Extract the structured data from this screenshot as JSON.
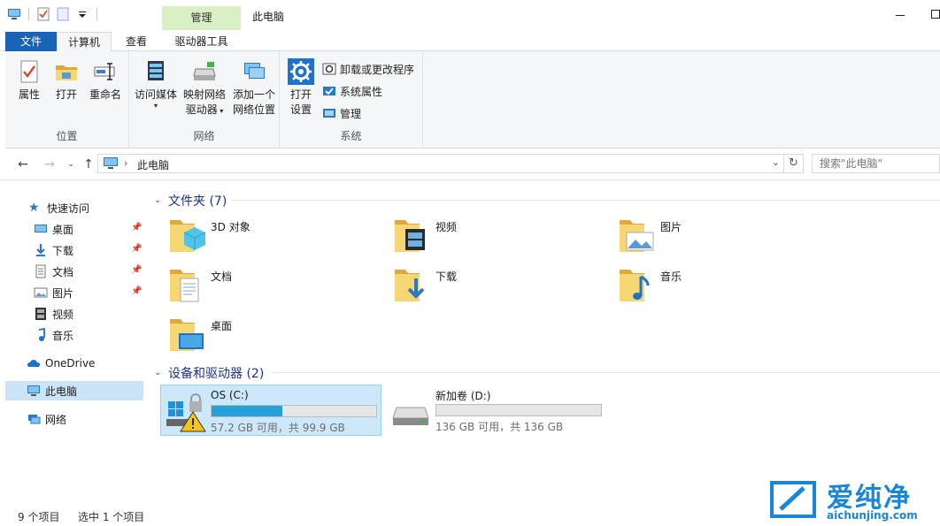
{
  "window": {
    "title": "此电脑",
    "manage_context_tab": "管理"
  },
  "ribbon_tabs": {
    "file": "文件",
    "computer": "计算机",
    "view": "查看",
    "drive_tools": "驱动器工具"
  },
  "ribbon": {
    "location_group": {
      "label": "位置",
      "properties": "属性",
      "open": "打开",
      "rename": "重命名"
    },
    "network_group": {
      "label": "网络",
      "access_media": "访问媒体",
      "map_drive_line1": "映射网络",
      "map_drive_line2": "驱动器",
      "add_location_line1": "添加一个",
      "add_location_line2": "网络位置"
    },
    "system_group": {
      "label": "系统",
      "open_settings_line1": "打开",
      "open_settings_line2": "设置",
      "uninstall": "卸载或更改程序",
      "system_properties": "系统属性",
      "manage": "管理"
    }
  },
  "address": {
    "path": "此电脑",
    "search_placeholder": "搜索\"此电脑\""
  },
  "sidebar": {
    "quick_access": "快速访问",
    "items": [
      {
        "label": "桌面",
        "pinned": true
      },
      {
        "label": "下载",
        "pinned": true
      },
      {
        "label": "文档",
        "pinned": true
      },
      {
        "label": "图片",
        "pinned": true
      },
      {
        "label": "视频",
        "pinned": false
      },
      {
        "label": "音乐",
        "pinned": false
      }
    ],
    "onedrive": "OneDrive",
    "this_pc": "此电脑",
    "network": "网络"
  },
  "folders_section": {
    "title": "文件夹 (7)",
    "folders": [
      {
        "label": "3D 对象",
        "icon": "3d-objects-folder-icon"
      },
      {
        "label": "视频",
        "icon": "videos-folder-icon"
      },
      {
        "label": "图片",
        "icon": "pictures-folder-icon"
      },
      {
        "label": "文档",
        "icon": "documents-folder-icon"
      },
      {
        "label": "下载",
        "icon": "downloads-folder-icon"
      },
      {
        "label": "音乐",
        "icon": "music-folder-icon"
      },
      {
        "label": "桌面",
        "icon": "desktop-folder-icon"
      }
    ]
  },
  "drives_section": {
    "title": "设备和驱动器 (2)",
    "drives": [
      {
        "label": "OS (C:)",
        "size_text": "57.2 GB 可用，共 99.9 GB",
        "used_fraction": 0.43,
        "selected": true
      },
      {
        "label": "新加卷 (D:)",
        "size_text": "136 GB 可用，共 136 GB",
        "used_fraction": 0.0,
        "selected": false
      }
    ]
  },
  "status": {
    "item_count": "9 个项目",
    "selected": "选中 1 个项目"
  },
  "watermark": {
    "title": "爱纯净",
    "url": "aichunjing.com"
  },
  "colors": {
    "accent": "#1a64b8",
    "selection": "#cce8fa",
    "drive_fill": "#26a0da",
    "section_heading": "#1e3287",
    "folder_yellow": "#f7d774"
  }
}
